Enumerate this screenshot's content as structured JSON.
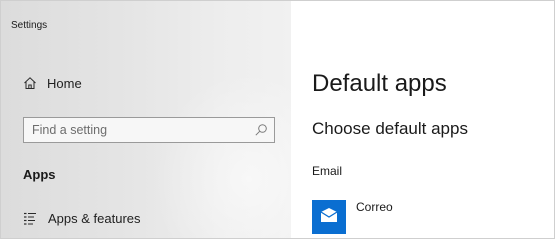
{
  "window": {
    "title": "Settings"
  },
  "sidebar": {
    "home": {
      "label": "Home",
      "icon": "home-icon"
    },
    "search": {
      "placeholder": "Find a setting",
      "icon": "search-icon"
    },
    "section": {
      "label": "Apps"
    },
    "items": [
      {
        "label": "Apps & features",
        "icon": "list-icon"
      }
    ]
  },
  "main": {
    "title": "Default apps",
    "subtitle": "Choose default apps",
    "categories": [
      {
        "label": "Email",
        "app_name": "Correo",
        "app_icon": "mail-icon",
        "tile_color": "#0a6ed1"
      }
    ]
  }
}
